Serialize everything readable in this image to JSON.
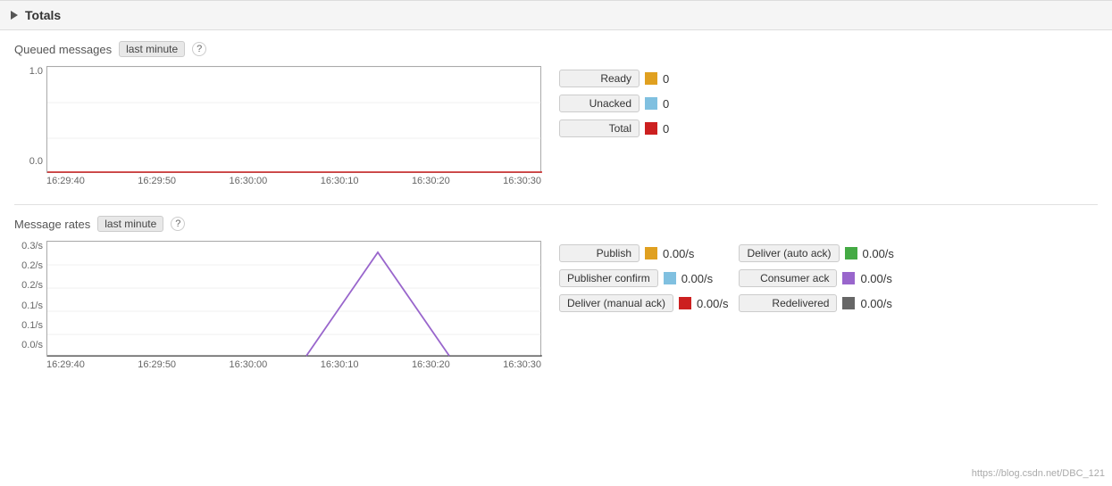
{
  "header": {
    "title": "Totals",
    "triangle": "▶"
  },
  "queued_messages": {
    "label": "Queued messages",
    "badge": "last minute",
    "question": "?",
    "chart": {
      "y_labels": [
        "1.0",
        "0.0"
      ],
      "x_labels": [
        "16:29:40",
        "16:29:50",
        "16:30:00",
        "16:30:10",
        "16:30:20",
        "16:30:30"
      ],
      "baseline_color": "#cc0000"
    },
    "legend": [
      {
        "label": "Ready",
        "color": "#e0a020",
        "value": "0"
      },
      {
        "label": "Unacked",
        "color": "#80c0e0",
        "value": "0"
      },
      {
        "label": "Total",
        "color": "#cc2020",
        "value": "0"
      }
    ]
  },
  "message_rates": {
    "label": "Message rates",
    "badge": "last minute",
    "question": "?",
    "chart": {
      "y_labels": [
        "0.3/s",
        "0.2/s",
        "0.2/s",
        "0.1/s",
        "0.1/s",
        "0.0/s"
      ],
      "x_labels": [
        "16:29:40",
        "16:29:50",
        "16:30:00",
        "16:30:10",
        "16:30:20",
        "16:30:30"
      ],
      "triangle_color": "#9966cc"
    },
    "legend_left": [
      {
        "label": "Publish",
        "color": "#e0a020",
        "value": "0.00/s"
      },
      {
        "label": "Publisher confirm",
        "color": "#80c0e0",
        "value": "0.00/s"
      },
      {
        "label": "Deliver (manual ack)",
        "color": "#cc2020",
        "value": "0.00/s"
      }
    ],
    "legend_right": [
      {
        "label": "Deliver (auto ack)",
        "color": "#44aa44",
        "value": "0.00/s"
      },
      {
        "label": "Consumer ack",
        "color": "#9966cc",
        "value": "0.00/s"
      },
      {
        "label": "Redelivered",
        "color": "#666666",
        "value": "0.00/s"
      }
    ]
  },
  "watermark": "https://blog.csdn.net/DBC_121"
}
